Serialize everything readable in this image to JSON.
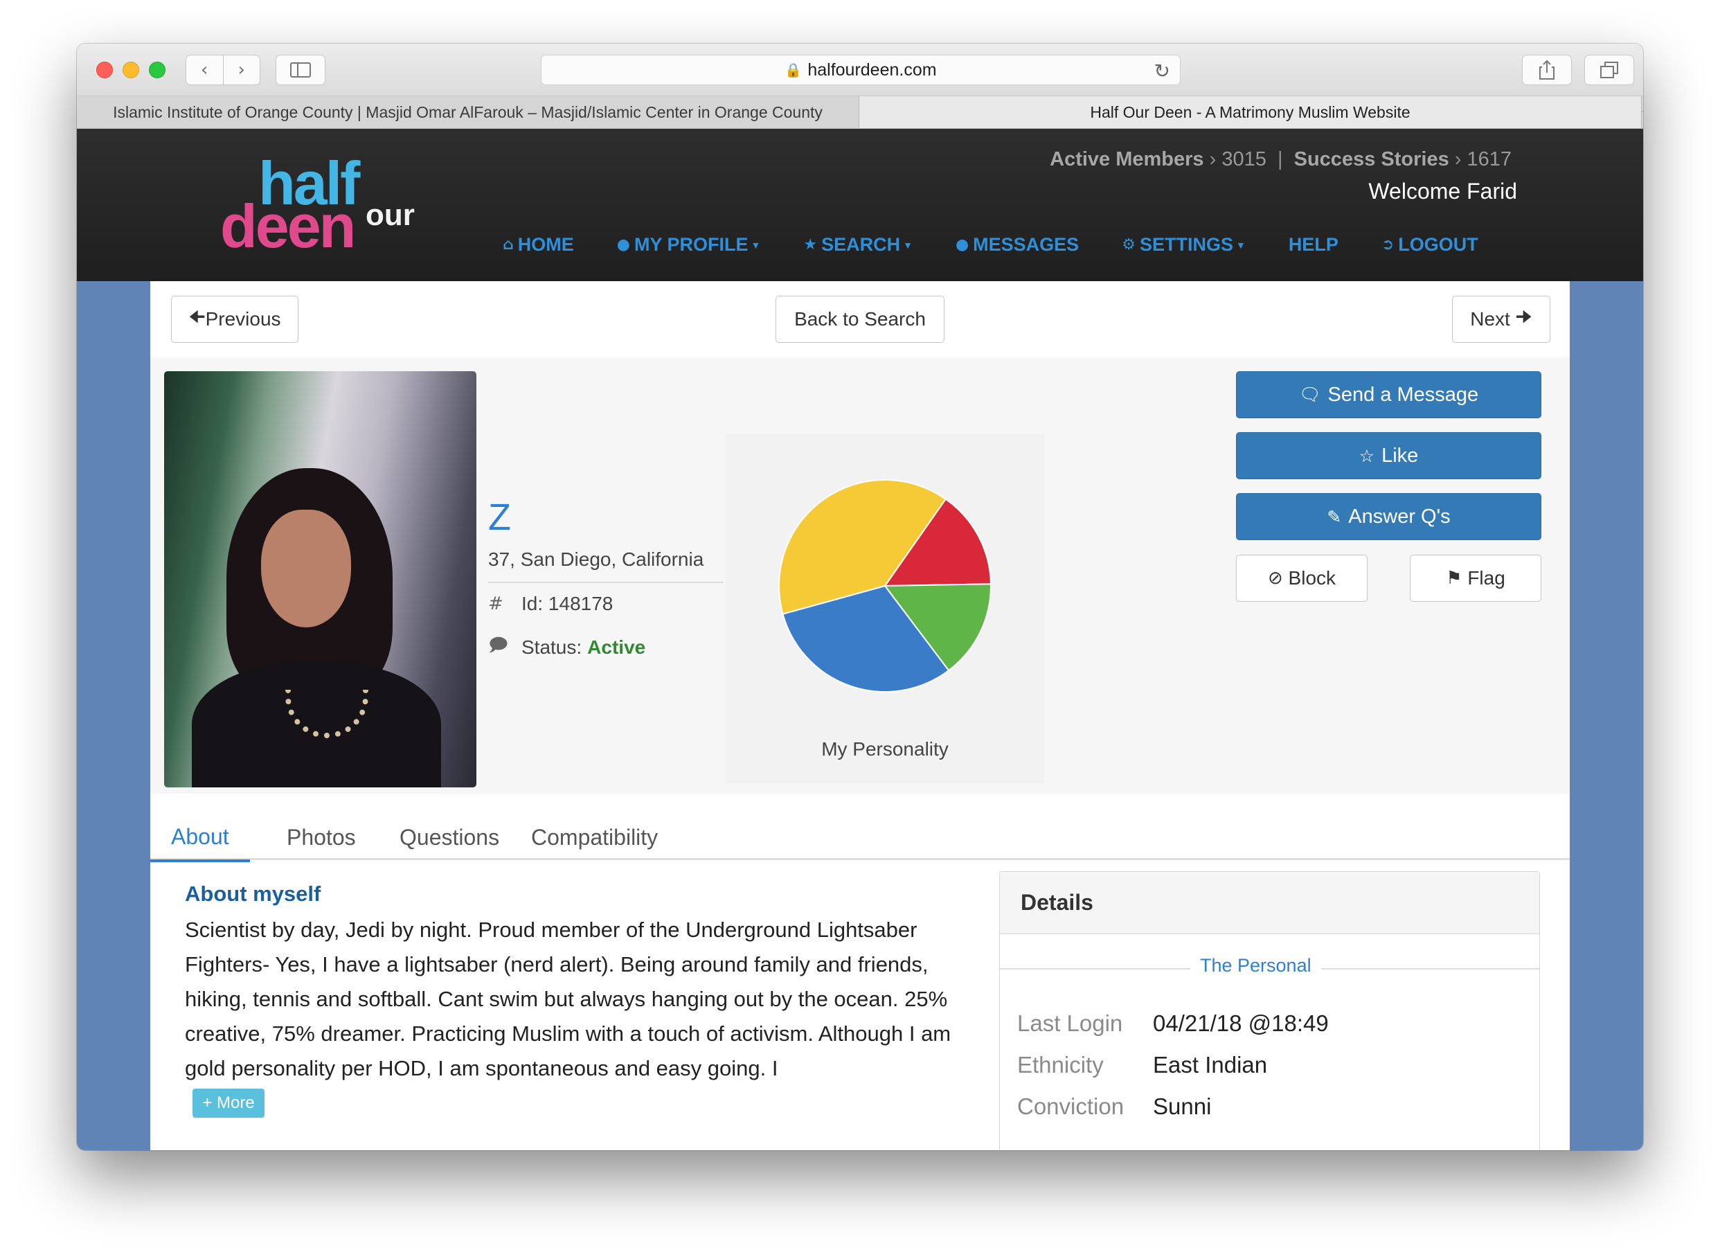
{
  "browser": {
    "url": "halfourdeen.com",
    "tabs": [
      {
        "title": "Islamic Institute of Orange County | Masjid Omar AlFarouk – Masjid/Islamic Center in Orange County"
      },
      {
        "title": "Half Our Deen - A Matrimony Muslim Website"
      }
    ]
  },
  "header": {
    "logo": {
      "half": "half",
      "deen": "deen",
      "our": "our"
    },
    "active_members_label": "Active Members",
    "active_members_count": "3015",
    "success_stories_label": "Success Stories",
    "success_stories_count": "1617",
    "welcome": "Welcome Farid",
    "nav": {
      "home": "HOME",
      "my_profile": "MY PROFILE",
      "search": "SEARCH",
      "messages": "MESSAGES",
      "settings": "SETTINGS",
      "help": "HELP",
      "logout": "LOGOUT"
    }
  },
  "pager": {
    "previous": "Previous",
    "back": "Back to Search",
    "next": "Next"
  },
  "profile": {
    "name": "Z",
    "location": "37, San Diego, California",
    "id_label": "Id:",
    "id_value": "148178",
    "status_label": "Status:",
    "status_value": "Active"
  },
  "actions": {
    "send_message": "Send a Message",
    "like": "Like",
    "answer": "Answer Q's",
    "block": "Block",
    "flag": "Flag"
  },
  "chart_data": {
    "type": "pie",
    "title": "My Personality",
    "values": [
      15,
      15,
      31,
      39
    ],
    "colors": [
      "#d9283a",
      "#5fb548",
      "#3b7cc9",
      "#f6c936"
    ]
  },
  "tabs": {
    "about": "About",
    "photos": "Photos",
    "questions": "Questions",
    "compatibility": "Compatibility"
  },
  "about": {
    "heading": "About myself",
    "text": "Scientist by day, Jedi by night. Proud member of the Underground Lightsaber Fighters- Yes, I have a lightsaber (nerd alert). Being around family and friends, hiking, tennis and softball. Cant swim but always hanging out by the ocean. 25% creative, 75% dreamer. Practicing Muslim with a touch of activism. Although I am gold personality per HOD, I am spontaneous and easy going. I",
    "more": "More"
  },
  "details": {
    "title": "Details",
    "section": "The Personal",
    "rows": [
      {
        "key": "Last Login",
        "value": "04/21/18 @18:49"
      },
      {
        "key": "Ethnicity",
        "value": "East Indian"
      },
      {
        "key": "Conviction",
        "value": "Sunni"
      }
    ]
  }
}
